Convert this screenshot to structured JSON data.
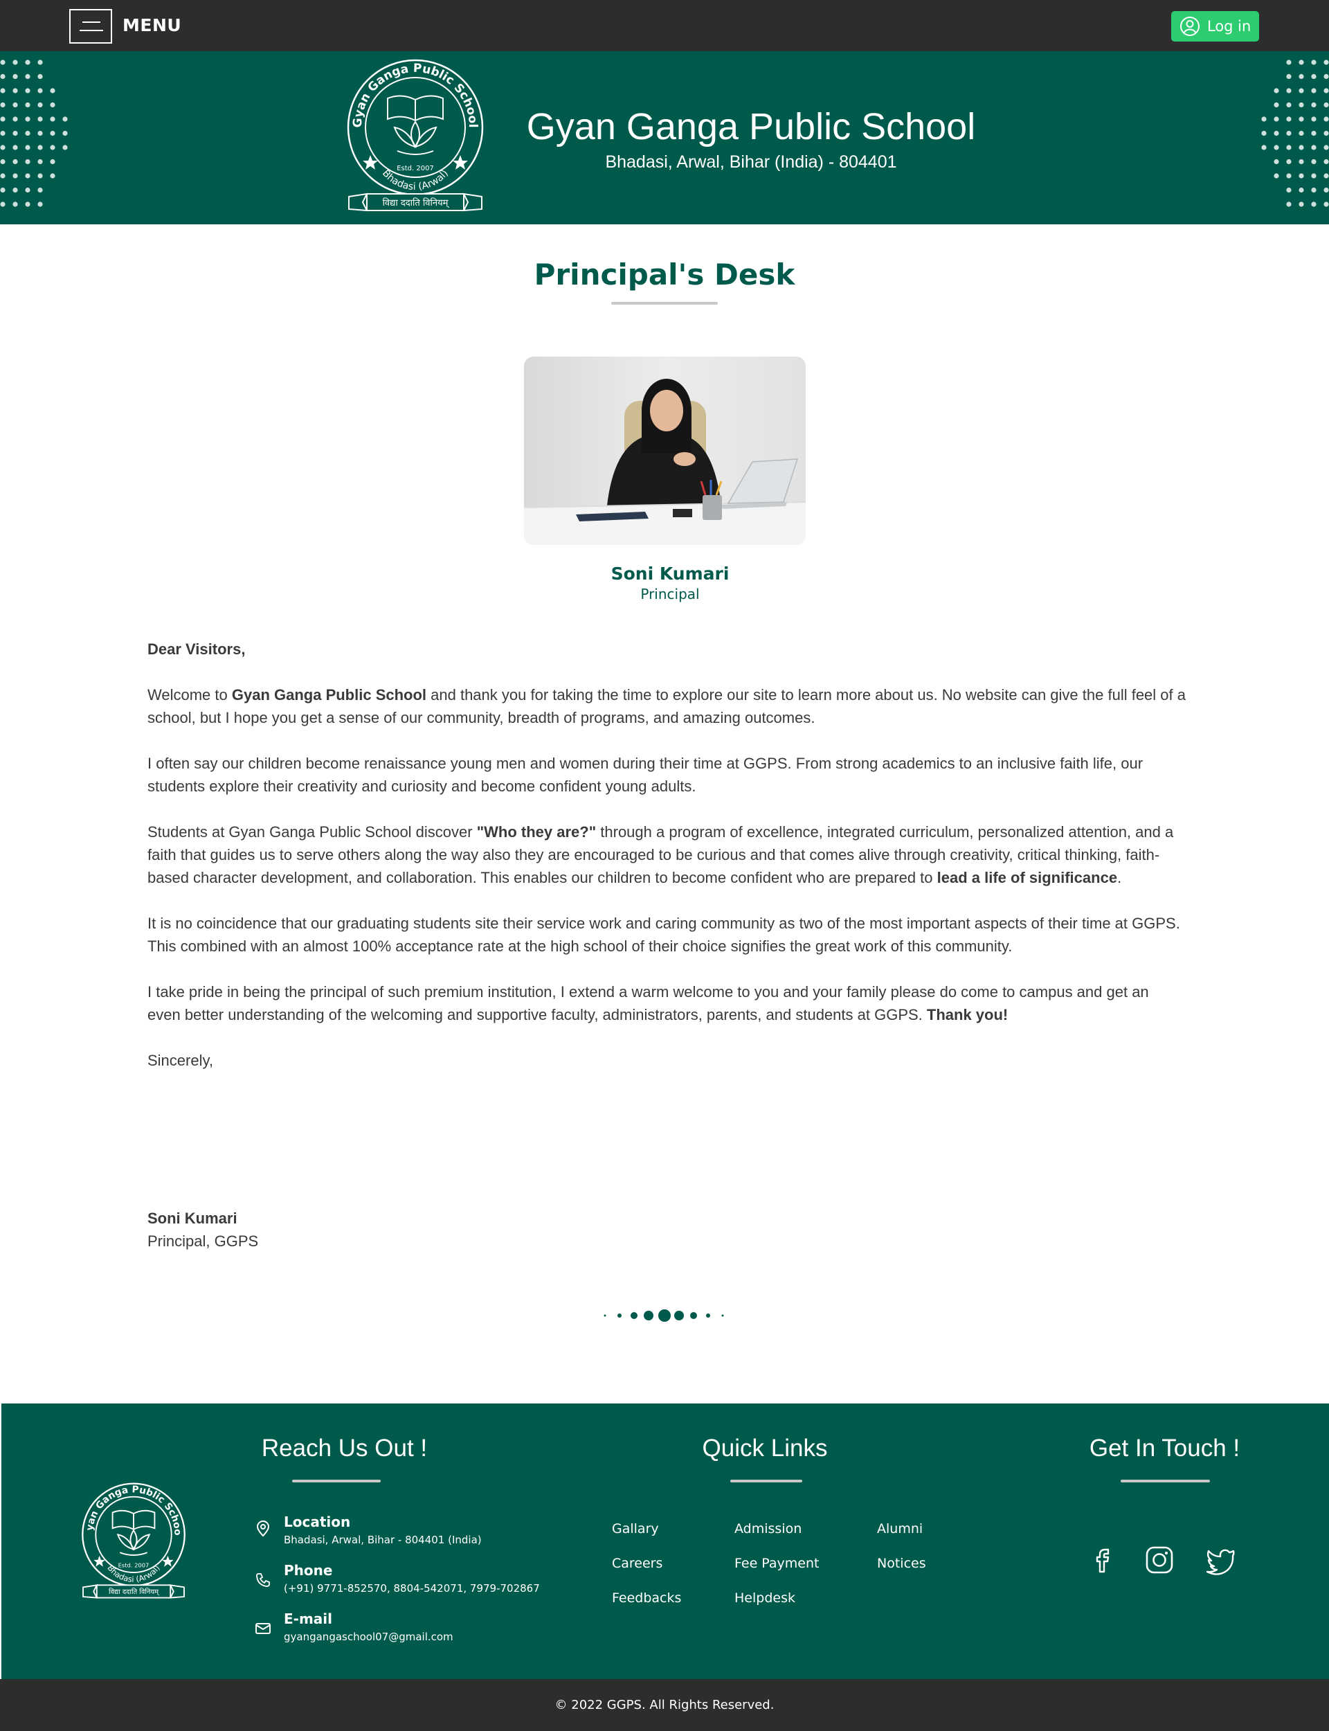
{
  "topbar": {
    "menu_label": "MENU",
    "login_label": "Log in"
  },
  "banner": {
    "school_name": "Gyan Ganga Public School",
    "address": "Bhadasi, Arwal, Bihar (India) - 804401",
    "logo_text": "Gyan Ganga Public School",
    "logo_estd": "Estd. 2007",
    "logo_place": "Bhadasi (Arwal)",
    "logo_motto": "विद्या ददाति विनियम्"
  },
  "main": {
    "title": "Principal's Desk",
    "principal_name": "Soni Kumari",
    "principal_role": "Principal",
    "greeting": "Dear Visitors,",
    "p1_a": "Welcome to ",
    "p1_b": "Gyan Ganga Public School",
    "p1_c": " and thank you for taking the time to explore our site to learn more about us. No website can give the full feel of a school, but I hope you get a sense of our community, breadth of programs, and amazing outcomes.",
    "p2": "I often say our children become renaissance young men and women during their time at GGPS. From strong academics to an inclusive faith life, our students explore their creativity and curiosity and become confident young adults.",
    "p3_a": "Students at Gyan Ganga Public School discover ",
    "p3_b": "\"Who they are?\"",
    "p3_c": " through a program of excellence, integrated curriculum, personalized attention, and a faith that guides us to serve others along the way also they are encouraged to be curious and that comes alive through creativity, critical thinking, faith-based character development, and collaboration. This enables our children to become confident who are prepared to ",
    "p3_d": "lead a life of significance",
    "p3_e": ".",
    "p4": "It is no coincidence that our graduating students site their service work and caring community as two of the most important aspects of their time at GGPS. This combined with an almost 100% acceptance rate at the high school of their choice signifies the great work of this community.",
    "p5_a": "I take pride in being the principal of such premium institution, I extend a warm welcome to you and your family please do come to campus and get an even better understanding of the welcoming and supportive faculty, administrators, parents, and students at GGPS. ",
    "p5_b": "Thank you!",
    "closing": "Sincerely,",
    "sign_name": "Soni Kumari",
    "sign_role": "Principal, GGPS"
  },
  "footer": {
    "reach_title": "Reach Us Out !",
    "links_title": "Quick Links",
    "touch_title": "Get In Touch !",
    "contacts": [
      {
        "title": "Location",
        "value": "Bhadasi, Arwal, Bihar - 804401 (India)",
        "icon": "location-icon"
      },
      {
        "title": "Phone",
        "value": "(+91) 9771-852570, 8804-542071, 7979-702867",
        "icon": "phone-icon"
      },
      {
        "title": "E-mail",
        "value": "gyangangaschool07@gmail.com",
        "icon": "mail-icon"
      }
    ],
    "links": [
      "Gallary",
      "Admission",
      "Alumni",
      "Careers",
      "Fee Payment",
      "Notices",
      "Feedbacks",
      "Helpdesk"
    ],
    "social": [
      "facebook-icon",
      "instagram-icon",
      "twitter-icon"
    ],
    "copyright": "© 2022 GGPS. All Rights Reserved."
  },
  "colors": {
    "brand_green": "#005a4b",
    "dark_bar": "#2d2d2d",
    "login_green": "#2ecc71"
  }
}
